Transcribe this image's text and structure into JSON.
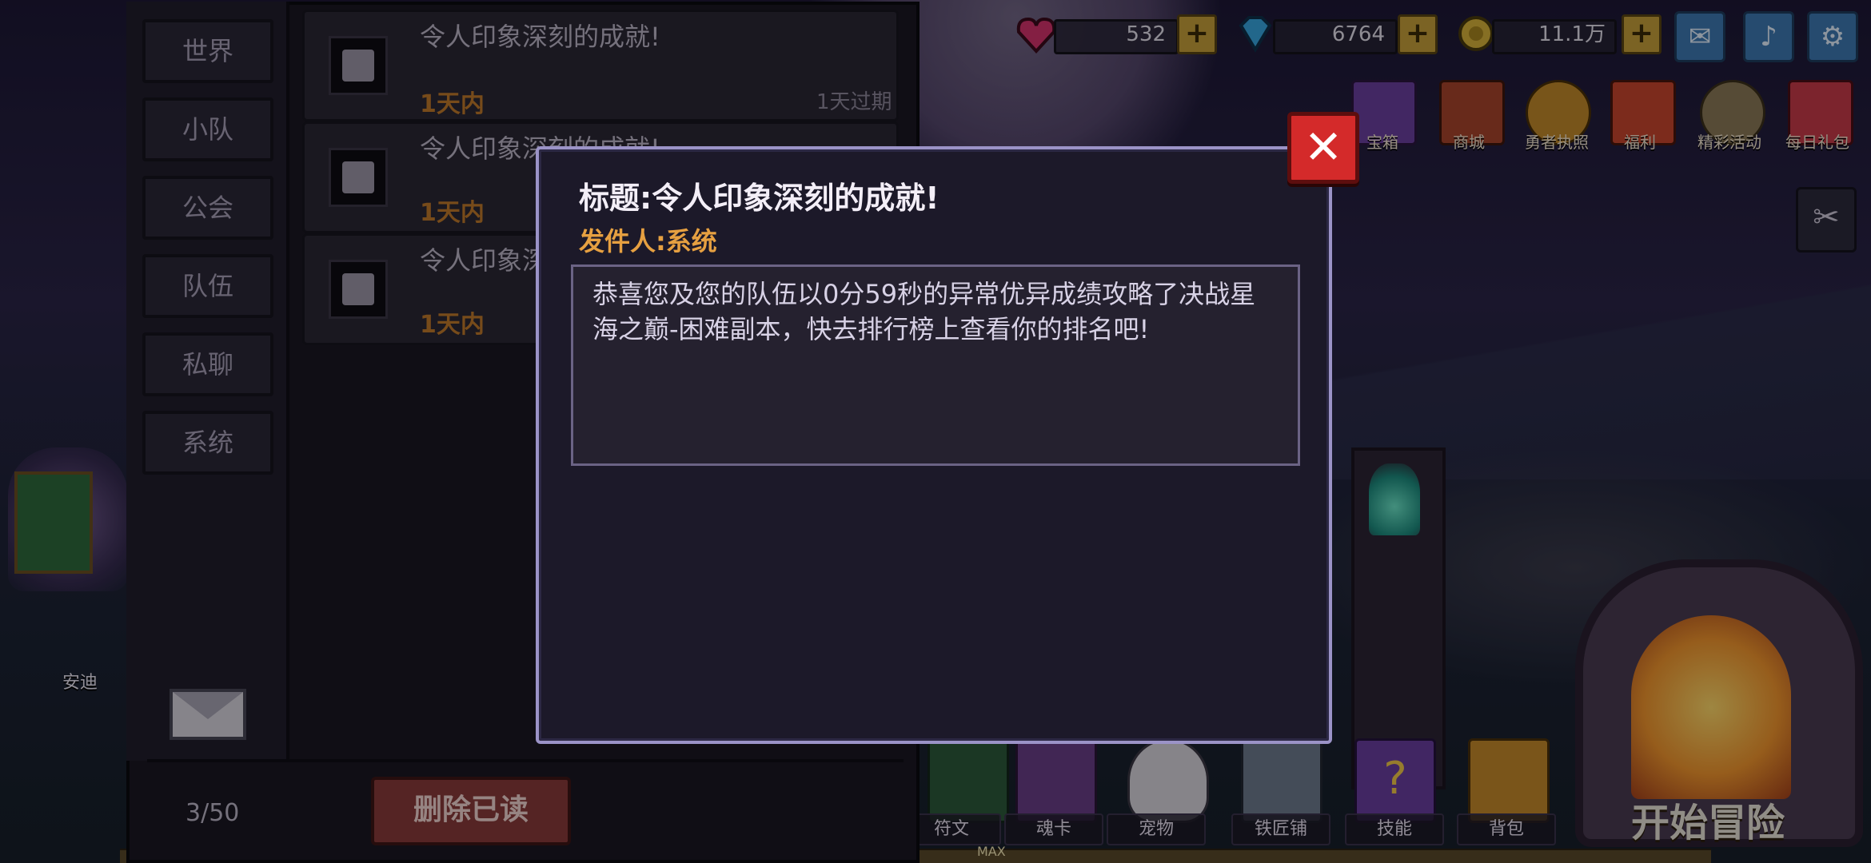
{
  "resources": [
    {
      "icon": "heart-gem-icon",
      "value": "532"
    },
    {
      "icon": "diamond-icon",
      "value": "6764"
    },
    {
      "icon": "gold-coin-icon",
      "value": "11.1万"
    }
  ],
  "top_menu": [
    {
      "label": "宝箱",
      "icon": "treasure-chest-icon"
    },
    {
      "label": "商城",
      "icon": "shop-icon"
    },
    {
      "label": "勇者执照",
      "icon": "hero-license-icon"
    },
    {
      "label": "福利",
      "icon": "welfare-gift-icon"
    },
    {
      "label": "精彩活动",
      "icon": "events-icon"
    },
    {
      "label": "每日礼包",
      "icon": "daily-gift-icon"
    }
  ],
  "mail_panel": {
    "categories": [
      "世界",
      "小队",
      "公会",
      "队伍",
      "私聊",
      "系统"
    ],
    "items": [
      {
        "title": "令人印象深刻的成就!",
        "time": "1天内",
        "expire": "1天过期"
      },
      {
        "title": "令人印象深刻的成就!",
        "time": "1天内",
        "expire": ""
      },
      {
        "title": "令人印象深刻的成就!",
        "time": "1天内",
        "expire": ""
      }
    ],
    "count": "3/50",
    "delete_label": "删除已读"
  },
  "background_labels": {
    "character_name": "安迪",
    "max": "MAX",
    "start": "开始冒险"
  },
  "dock": [
    "符文",
    "魂卡",
    "宠物",
    "铁匠铺",
    "技能",
    "背包"
  ],
  "modal": {
    "title": "标题:令人印象深刻的成就!",
    "sender": "发件人:系统",
    "body": "恭喜您及您的队伍以0分59秒的异常优异成绩攻略了决战星海之巅-困难副本，快去排行榜上查看你的排名吧!",
    "close": "✕"
  },
  "colors": {
    "modal_border": "#9b93c7",
    "sender_text": "#e6a041",
    "close_button": "#d42a2a",
    "time_text": "#c07a2b"
  }
}
